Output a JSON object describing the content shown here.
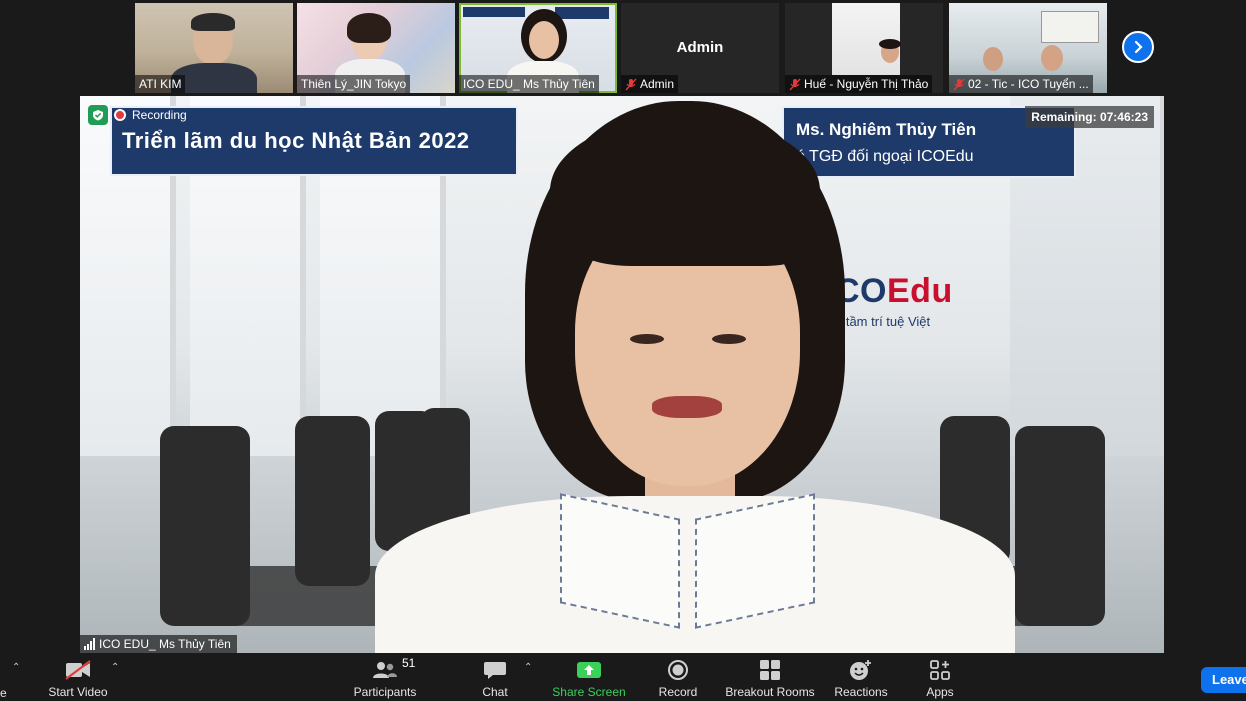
{
  "participants": [
    {
      "name": "ATI KIM",
      "muted": false,
      "active": false
    },
    {
      "name": "Thiên Lý_JIN Tokyo",
      "muted": false,
      "active": false
    },
    {
      "name": "ICO EDU_ Ms Thủy Tiên",
      "muted": false,
      "active": true
    },
    {
      "name": "Admin",
      "muted": true,
      "active": false,
      "display_name": "Admin"
    },
    {
      "name": "Huế - Nguyễn Thị Thảo",
      "muted": true,
      "active": false
    },
    {
      "name": "02 - Tic - ICO Tuyển ...",
      "muted": true,
      "active": false
    }
  ],
  "stage": {
    "speaker_name": "ICO EDU_ Ms Thủy Tiên",
    "recording_label": "Recording",
    "remaining": "Remaining: 07:46:23",
    "banner_left": "Triển lãm du học Nhật Bản 2022",
    "banner_right_line1": "Ms. Nghiêm Thủy Tiên",
    "banner_right_line2": "ó TGĐ đối ngoại ICOEdu",
    "logo_ico": "CO",
    "logo_edu": "Edu",
    "tagline": "g tầm trí tuệ Việt"
  },
  "toolbar": {
    "edge_label": "e",
    "start_video": "Start Video",
    "participants": "Participants",
    "participants_count": "51",
    "chat": "Chat",
    "share_screen": "Share Screen",
    "record": "Record",
    "breakout_rooms": "Breakout Rooms",
    "reactions": "Reactions",
    "apps": "Apps",
    "leave": "Leave"
  },
  "colors": {
    "accent_blue": "#0e72ed",
    "share_green": "#3ad05a",
    "active_border": "#7dbb36",
    "muted_red": "#e03c3c",
    "banner_navy": "#1e3a6b"
  },
  "icons": [
    "next-page-icon",
    "mic-off-icon",
    "shield-icon",
    "recording-dot-icon",
    "signal-icon",
    "video-off-icon",
    "participants-icon",
    "chat-icon",
    "share-screen-icon",
    "record-icon",
    "breakout-rooms-icon",
    "reactions-icon",
    "apps-icon",
    "caret-up-icon"
  ]
}
